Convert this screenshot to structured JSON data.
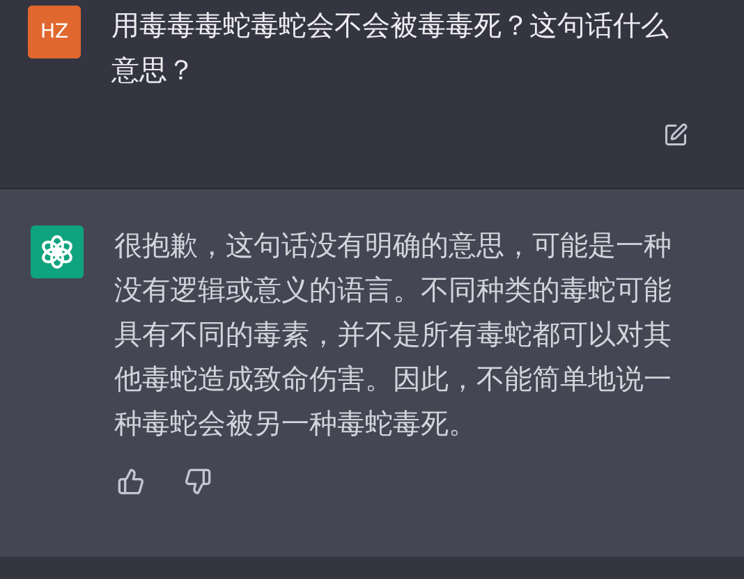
{
  "messages": [
    {
      "kind": "user",
      "avatar": "HZ",
      "text": "用毒毒毒蛇毒蛇会不会被毒毒死？这句话什么意思？"
    },
    {
      "kind": "assistant",
      "text": "很抱歉，这句话没有明确的意思，可能是一种没有逻辑或意义的语言。不同种类的毒蛇可能具有不同的毒素，并不是所有毒蛇都可以对其他毒蛇造成致命伤害。因此，不能简单地说一种毒蛇会被另一种毒蛇毒死。"
    }
  ]
}
